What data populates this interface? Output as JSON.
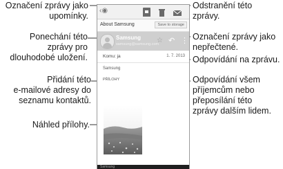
{
  "callouts": {
    "mark_reminder": [
      "Označení zprávy jako",
      "upomínky."
    ],
    "keep_storage": [
      "Ponechání této",
      "zprávy pro",
      "dlouhodobé uložení."
    ],
    "add_contact": [
      "Přidání této",
      "e-mailové adresy do",
      "seznamu kontaktů."
    ],
    "attachment_preview": [
      "Náhled přílohy."
    ],
    "delete_msg": [
      "Odstranění této",
      "zprávy."
    ],
    "mark_unread": [
      "Označení zprávy jako",
      "nepřečtené."
    ],
    "reply": [
      "Odpovídání na zprávu."
    ],
    "reply_all": [
      "Odpovídání všem",
      "příjemcům nebo",
      "přeposílání této",
      "zprávy dalším lidem."
    ]
  },
  "screen": {
    "about_label": "About Samsung",
    "about_button": "Save to storage",
    "sender_name": "Samsung",
    "sender_email": "samsung@samsung.com",
    "to_label": "Komu: ja",
    "date": "1. 7. 2013",
    "msg_from": "Samsung",
    "attachment": "PŘÍLOHY",
    "bottom_text": "Samsung"
  },
  "colors": {
    "sender_bar": "#cfcfcf",
    "line": "#333333"
  },
  "icons": [
    "back-arrow-icon",
    "save-icon",
    "trash-icon",
    "mail-unread-icon",
    "star-icon",
    "reply-icon",
    "more-icon",
    "contact-avatar-icon"
  ]
}
